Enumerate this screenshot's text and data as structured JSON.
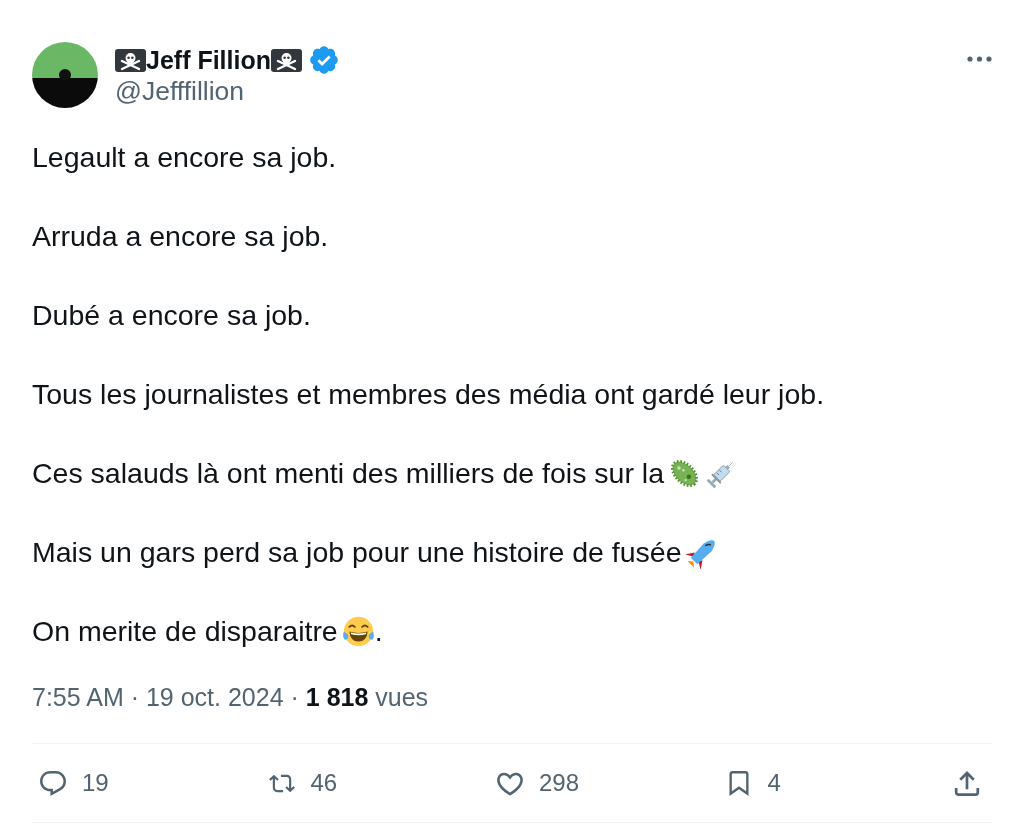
{
  "post": {
    "author": {
      "name_parts": [
        {
          "kind": "pirate-flag"
        },
        {
          "kind": "text",
          "text": "Jeff Fillion"
        },
        {
          "kind": "pirate-flag"
        }
      ],
      "verified": true,
      "handle": "@Jefffillion"
    },
    "paragraphs": [
      [
        {
          "kind": "text",
          "text": "Legault a encore sa job."
        }
      ],
      [
        {
          "kind": "text",
          "text": "Arruda a encore sa job."
        }
      ],
      [
        {
          "kind": "text",
          "text": "Dubé a encore sa job."
        }
      ],
      [
        {
          "kind": "text",
          "text": "Tous les journalistes et membres des média ont gardé leur job."
        }
      ],
      [
        {
          "kind": "text",
          "text": "Ces salauds là ont menti des milliers de fois sur la"
        },
        {
          "kind": "microbe"
        },
        {
          "kind": "syringe"
        }
      ],
      [
        {
          "kind": "text",
          "text": "Mais un gars perd sa job pour une histoire de fusée"
        },
        {
          "kind": "rocket"
        }
      ],
      [
        {
          "kind": "text",
          "text": "On merite de disparaitre"
        },
        {
          "kind": "tears-of-joy"
        },
        {
          "kind": "text",
          "text": "."
        }
      ]
    ],
    "meta": "7:55 AM · 19 oct. 2024 · **1 818** vues",
    "actions": [
      {
        "kind": "reply",
        "count": "19"
      },
      {
        "kind": "repost",
        "count": "46"
      },
      {
        "kind": "like",
        "count": "298"
      },
      {
        "kind": "bookmark",
        "count": "4"
      },
      {
        "kind": "share"
      }
    ]
  }
}
